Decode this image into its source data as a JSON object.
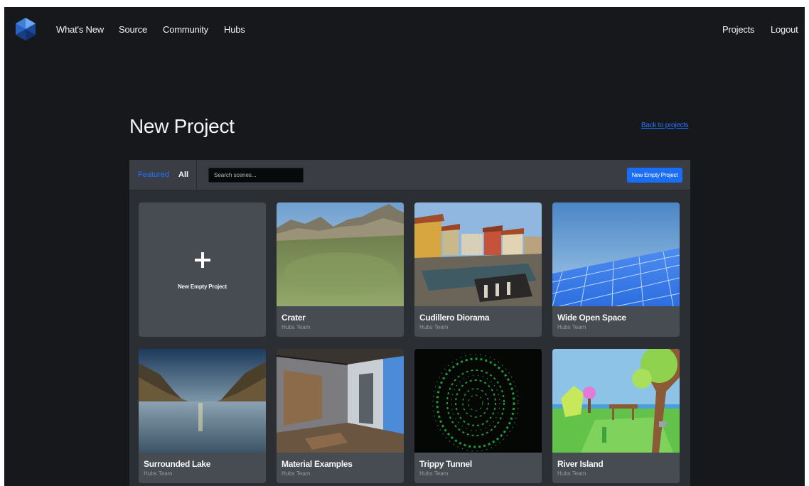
{
  "nav": {
    "logo": "spoke-logo-icon",
    "links_left": [
      "What's New",
      "Source",
      "Community",
      "Hubs"
    ],
    "links_right": [
      "Projects",
      "Logout"
    ]
  },
  "page": {
    "title": "New Project",
    "back_link": "Back to projects"
  },
  "toolbar": {
    "tabs": [
      "Featured",
      "All"
    ],
    "active_tab": "Featured",
    "search_placeholder": "Search scenes...",
    "new_empty_button": "New Empty Project"
  },
  "empty_card": {
    "icon": "plus-icon",
    "label": "New Empty Project"
  },
  "scenes": [
    {
      "title": "Crater",
      "author": "Hubs Team"
    },
    {
      "title": "Cudillero Diorama",
      "author": "Hubs Team"
    },
    {
      "title": "Wide Open Space",
      "author": "Hubs Team"
    },
    {
      "title": "Surrounded Lake",
      "author": "Hubs Team"
    },
    {
      "title": "Material Examples",
      "author": "Hubs Team"
    },
    {
      "title": "Trippy Tunnel",
      "author": "Hubs Team"
    },
    {
      "title": "River Island",
      "author": "Hubs Team"
    }
  ],
  "colors": {
    "background": "#17181b",
    "panel": "#2b2e33",
    "card": "#474b52",
    "accent": "#1f74ff"
  }
}
